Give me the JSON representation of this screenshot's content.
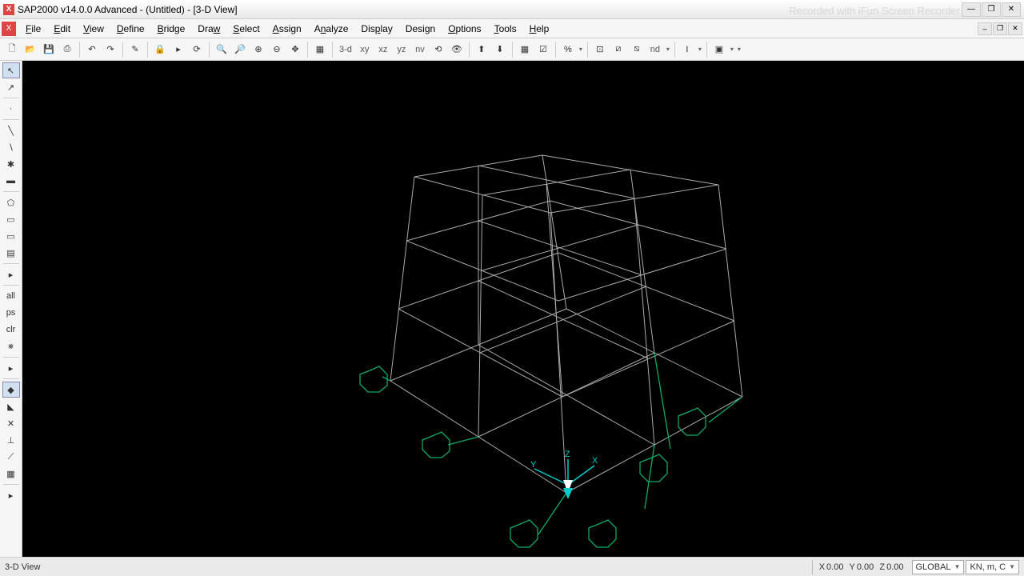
{
  "title": "SAP2000 v14.0.0 Advanced  - (Untitled) - [3-D View]",
  "watermark": "Recorded with iFun Screen Recorder",
  "menus": {
    "file": "File",
    "edit": "Edit",
    "view": "View",
    "define": "Define",
    "bridge": "Bridge",
    "draw": "Draw",
    "select": "Select",
    "assign": "Assign",
    "analyze": "Analyze",
    "display": "Display",
    "design": "Design",
    "options": "Options",
    "tools": "Tools",
    "help": "Help"
  },
  "toolbar_views": {
    "v3d": "3-d",
    "xy": "xy",
    "xz": "xz",
    "yz": "yz",
    "nv": "nv",
    "nd": "nd"
  },
  "left_labels": {
    "all": "all",
    "ps": "ps",
    "clr": "clr"
  },
  "status": {
    "view": "3-D View",
    "coords": {
      "x_label": "X",
      "x_val": "0.00",
      "y_label": "Y",
      "y_val": "0.00",
      "z_label": "Z",
      "z_val": "0.00"
    },
    "coord_system": "GLOBAL",
    "units": "KN, m, C"
  }
}
